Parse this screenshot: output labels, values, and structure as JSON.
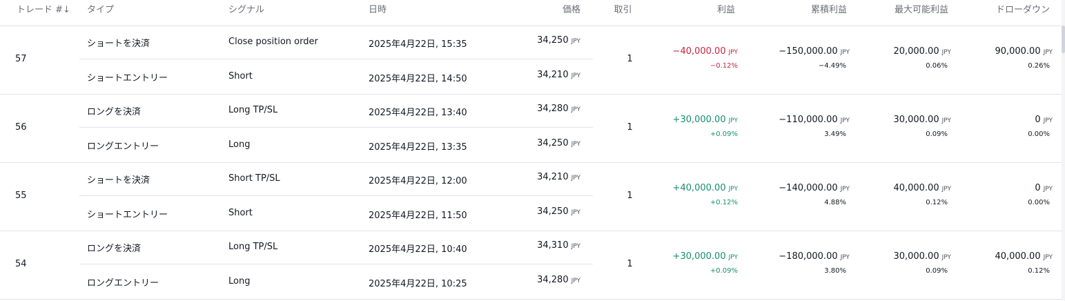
{
  "headers": {
    "trade": "トレード #",
    "sort": "↓",
    "type": "タイプ",
    "signal": "シグナル",
    "datetime": "日時",
    "price": "価格",
    "contracts": "取引",
    "profit": "利益",
    "cum_profit": "累積利益",
    "runup": "最大可能利益",
    "drawdown": "ドローダウン"
  },
  "currency": "JPY",
  "trades": [
    {
      "no": "57",
      "exit": {
        "type": "ショートを決済",
        "signal": "Close position order",
        "datetime": "2025年4月22日, 15:35",
        "price": "34,250"
      },
      "entry": {
        "type": "ショートエントリー",
        "signal": "Short",
        "datetime": "2025年4月22日, 14:50",
        "price": "34,210"
      },
      "contracts": "1",
      "profit": "−40,000.00",
      "profit_pct": "−0.12%",
      "profit_sign": "neg",
      "cum_profit": "−150,000.00",
      "cum_profit_pct": "−4.49%",
      "runup": "20,000.00",
      "runup_pct": "0.06%",
      "drawdown": "90,000.00",
      "drawdown_pct": "0.26%"
    },
    {
      "no": "56",
      "exit": {
        "type": "ロングを決済",
        "signal": "Long TP/SL",
        "datetime": "2025年4月22日, 13:40",
        "price": "34,280"
      },
      "entry": {
        "type": "ロングエントリー",
        "signal": "Long",
        "datetime": "2025年4月22日, 13:35",
        "price": "34,250"
      },
      "contracts": "1",
      "profit": "+30,000.00",
      "profit_pct": "+0.09%",
      "profit_sign": "pos",
      "cum_profit": "−110,000.00",
      "cum_profit_pct": "3.49%",
      "runup": "30,000.00",
      "runup_pct": "0.09%",
      "drawdown": "0",
      "drawdown_pct": "0.00%"
    },
    {
      "no": "55",
      "exit": {
        "type": "ショートを決済",
        "signal": "Short TP/SL",
        "datetime": "2025年4月22日, 12:00",
        "price": "34,210"
      },
      "entry": {
        "type": "ショートエントリー",
        "signal": "Short",
        "datetime": "2025年4月22日, 11:50",
        "price": "34,250"
      },
      "contracts": "1",
      "profit": "+40,000.00",
      "profit_pct": "+0.12%",
      "profit_sign": "pos",
      "cum_profit": "−140,000.00",
      "cum_profit_pct": "4.88%",
      "runup": "40,000.00",
      "runup_pct": "0.12%",
      "drawdown": "0",
      "drawdown_pct": "0.00%"
    },
    {
      "no": "54",
      "exit": {
        "type": "ロングを決済",
        "signal": "Long TP/SL",
        "datetime": "2025年4月22日, 10:40",
        "price": "34,310"
      },
      "entry": {
        "type": "ロングエントリー",
        "signal": "Long",
        "datetime": "2025年4月22日, 10:25",
        "price": "34,280"
      },
      "contracts": "1",
      "profit": "+30,000.00",
      "profit_pct": "+0.09%",
      "profit_sign": "pos",
      "cum_profit": "−180,000.00",
      "cum_profit_pct": "3.80%",
      "runup": "30,000.00",
      "runup_pct": "0.09%",
      "drawdown": "40,000.00",
      "drawdown_pct": "0.12%"
    }
  ]
}
